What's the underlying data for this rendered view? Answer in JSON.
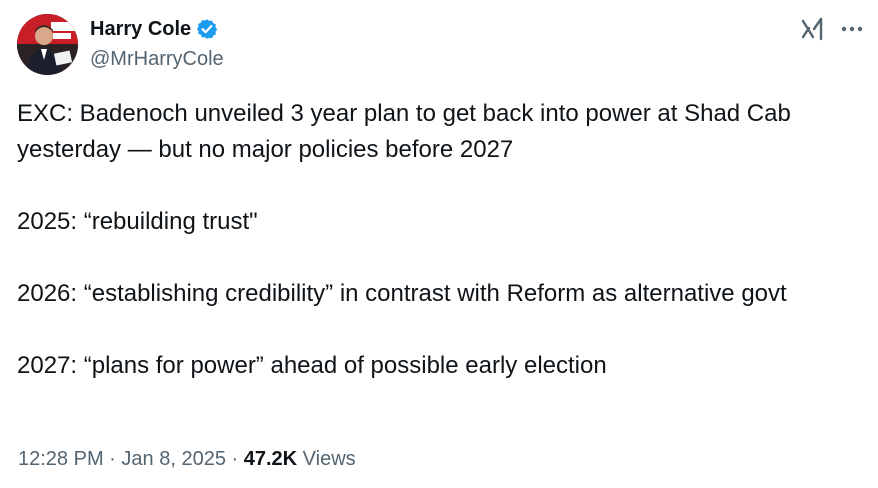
{
  "author": {
    "display_name": "Harry Cole",
    "handle": "@MrHarryCole",
    "verified": true,
    "verified_color": "#1d9bf0"
  },
  "actions": {
    "grok_icon": "grok-icon",
    "more_icon": "more-icon"
  },
  "tweet": {
    "paragraphs": [
      "EXC:  Badenoch unveiled 3 year plan to get back into power at Shad Cab yesterday — but no major policies before 2027",
      "2025: “rebuilding trust\"",
      "2026: “establishing credibility” in contrast with Reform as alternative govt",
      "2027: “plans for power” ahead of possible early election"
    ]
  },
  "meta": {
    "time": "12:28 PM",
    "separator": "·",
    "date": "Jan 8, 2025",
    "views_count": "47.2K",
    "views_label": "Views"
  },
  "colors": {
    "text_primary": "#0f1419",
    "text_secondary": "#536471",
    "background": "#ffffff"
  }
}
